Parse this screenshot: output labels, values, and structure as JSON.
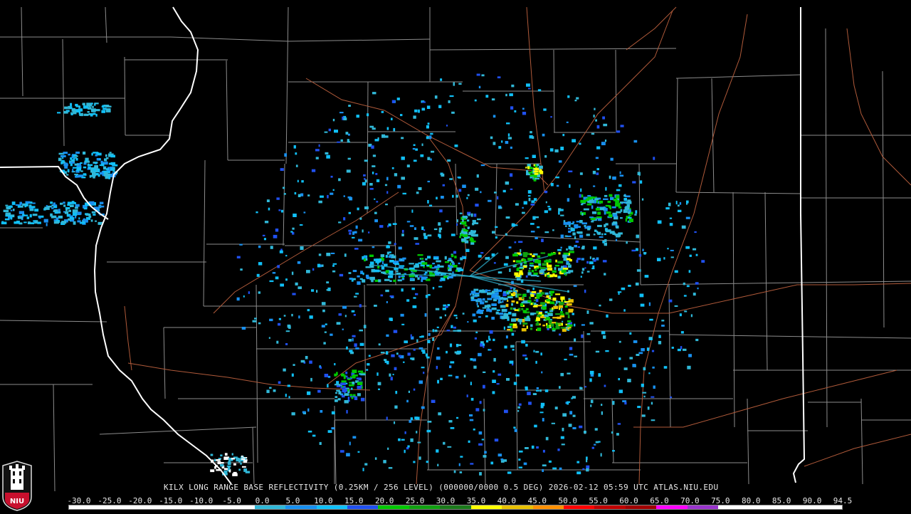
{
  "product": {
    "title": "KILX LONG RANGE BASE REFLECTIVITY (0.25KM / 256 LEVEL) (000000/0000 0.5 DEG) 2026-02-12 05:59 UTC  ATLAS.NIU.EDU"
  },
  "logo": {
    "text": "NIU",
    "colors": {
      "shield": "#c8102e",
      "tower": "#ffffff"
    }
  },
  "color_scale": {
    "ticks": [
      "-30.0",
      "-25.0",
      "-20.0",
      "-15.0",
      "-10.0",
      "-5.0",
      "0.0",
      "5.0",
      "10.0",
      "15.0",
      "20.0",
      "25.0",
      "30.0",
      "35.0",
      "40.0",
      "45.0",
      "50.0",
      "55.0",
      "60.0",
      "65.0",
      "70.0",
      "75.0",
      "80.0",
      "85.0",
      "90.0",
      "94.5"
    ],
    "colors": [
      "#ffffff",
      "#ffffff",
      "#ffffff",
      "#ffffff",
      "#ffffff",
      "#ffffff",
      "#30b8d8",
      "#1890f0",
      "#10c0f8",
      "#2050f0",
      "#00c800",
      "#10a010",
      "#1b7a1b",
      "#ffff00",
      "#e8c000",
      "#ff9000",
      "#ff0000",
      "#c00000",
      "#a00000",
      "#ff00ff",
      "#9933cc",
      "#ffffff",
      "#ffffff",
      "#ffffff",
      "#ffffff"
    ]
  },
  "map_colors": {
    "state_border": "#ffffff",
    "county_border": "#909090",
    "highway": "#b05a3a"
  }
}
